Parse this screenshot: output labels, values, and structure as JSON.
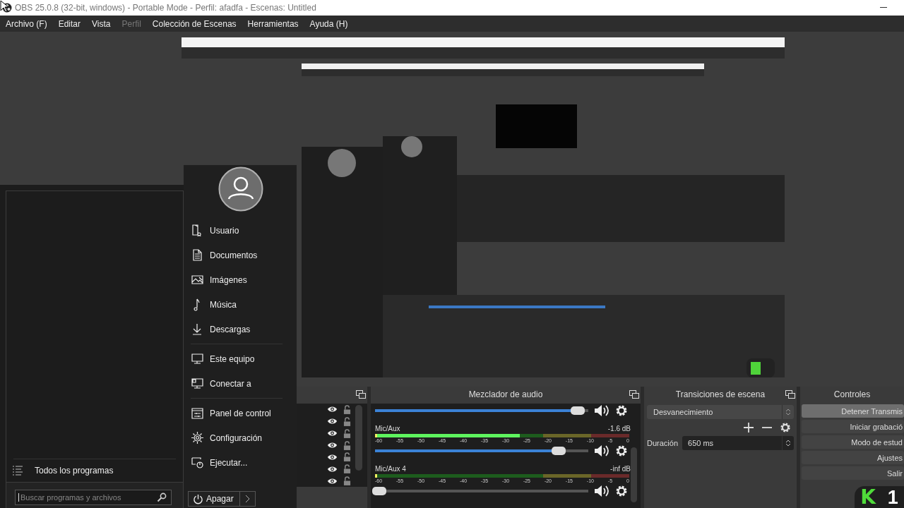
{
  "window": {
    "title": "OBS 25.0.8 (32-bit, windows) - Portable Mode - Perfil: afadfa - Escenas: Untitled"
  },
  "menu": [
    {
      "label": "Archivo (F)",
      "disabled": false
    },
    {
      "label": "Editar",
      "disabled": false
    },
    {
      "label": "Vista",
      "disabled": false
    },
    {
      "label": "Perfil",
      "disabled": true
    },
    {
      "label": "Colección de Escenas",
      "disabled": false
    },
    {
      "label": "Herramientas",
      "disabled": false
    },
    {
      "label": "Ayuda (H)",
      "disabled": false
    }
  ],
  "mixer": {
    "title": "Mezclador de audio",
    "channels": [
      {
        "volume": {
          "level": 0.95
        }
      },
      {
        "name": "Mic/Aux",
        "reading": "-1.6 dB",
        "meter": {
          "level": 0.57,
          "ticks": [
            "-60",
            "-55",
            "-50",
            "-45",
            "-40",
            "-35",
            "-30",
            "-25",
            "-20",
            "-15",
            "-10",
            "-5",
            "0"
          ]
        },
        "volume": {
          "level": 0.86
        }
      },
      {
        "name": "Mic/Aux 4",
        "reading": "-inf dB",
        "meter": {
          "level": 0,
          "ticks": [
            "-60",
            "-55",
            "-50",
            "-45",
            "-40",
            "-35",
            "-30",
            "-25",
            "-20",
            "-15",
            "-10",
            "-5",
            "0"
          ]
        },
        "volume": {
          "level": 0.02
        }
      }
    ]
  },
  "transitions": {
    "title": "Transiciones de escena",
    "select": "Desvanecimiento",
    "duration_label": "Duración",
    "duration": "650 ms"
  },
  "controls": {
    "title": "Controles",
    "buttons": [
      {
        "label": "Detener Transmis",
        "selected": true
      },
      {
        "label": "Iniciar grabació",
        "selected": false
      },
      {
        "label": "Modo de estud",
        "selected": false
      },
      {
        "label": "Ajustes",
        "selected": false
      },
      {
        "label": "Salir",
        "selected": false
      }
    ]
  },
  "logo": {
    "letter": "K",
    "number": "1"
  },
  "start_menu": {
    "all_programs": "Todos los programas",
    "search": {
      "placeholder": "Buscar programas y archivos"
    },
    "groups": [
      [
        "Usuario",
        "Documentos",
        "Imágenes",
        "Música",
        "Descargas"
      ],
      [
        "Este equipo",
        "Conectar a"
      ],
      [
        "Panel de control",
        "Configuración",
        "Ejecutar..."
      ]
    ],
    "shutdown": "Apagar"
  }
}
